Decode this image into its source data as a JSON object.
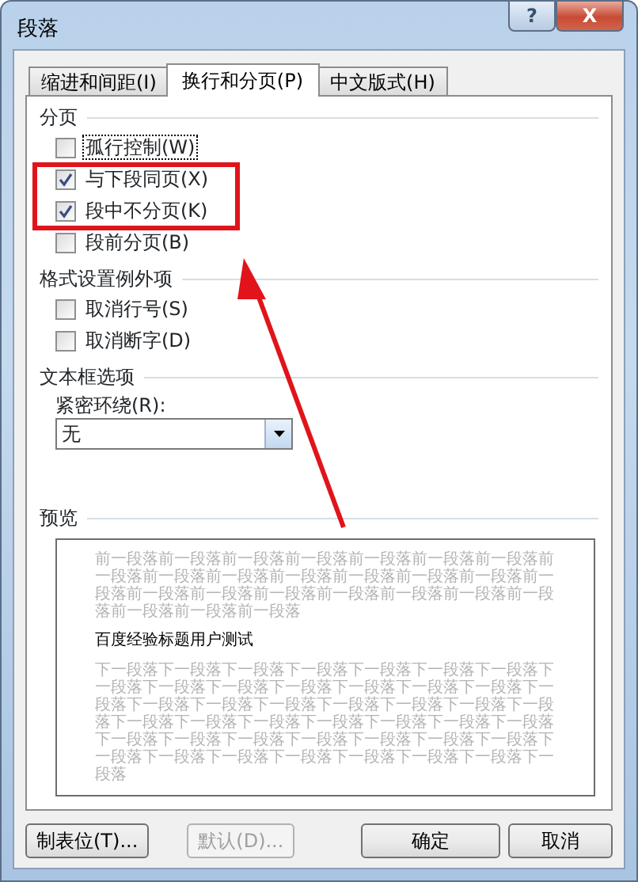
{
  "window": {
    "title": "段落",
    "buttons": [
      {
        "kind": "help",
        "label": "?"
      },
      {
        "kind": "close",
        "label": "X"
      }
    ]
  },
  "tabs": [
    {
      "label": "缩进和间距(I)",
      "selected": false
    },
    {
      "label": "换行和分页(P)",
      "selected": true
    },
    {
      "label": "中文版式(H)",
      "selected": false
    }
  ],
  "sections": [
    {
      "title": "分页",
      "items": [
        {
          "kind": "checkbox",
          "label": "孤行控制(W)",
          "checked": false,
          "focused": true
        },
        {
          "kind": "checkbox",
          "label": "与下段同页(X)",
          "checked": true,
          "focused": false
        },
        {
          "kind": "checkbox",
          "label": "段中不分页(K)",
          "checked": true,
          "focused": false
        },
        {
          "kind": "checkbox",
          "label": "段前分页(B)",
          "checked": false,
          "focused": false
        }
      ]
    },
    {
      "title": "格式设置例外项",
      "items": [
        {
          "kind": "checkbox",
          "label": "取消行号(S)",
          "checked": false,
          "focused": false
        },
        {
          "kind": "checkbox",
          "label": "取消断字(D)",
          "checked": false,
          "focused": false
        }
      ]
    },
    {
      "title": "文本框选项",
      "items": [
        {
          "kind": "label",
          "label": "紧密环绕(R):"
        },
        {
          "kind": "select",
          "value": "无"
        }
      ]
    }
  ],
  "preview": {
    "title": "预览",
    "before": "前一段落前一段落前一段落前一段落前一段落前一段落前一段落前一段落前一段落前一段落前一段落前一段落前一段落前一段落前一段落前一段落前一段落前一段落前一段落前一段落前一段落前一段落前一段落前一段落前一段落",
    "sample": "百度经验标题用户测试",
    "after": "下一段落下一段落下一段落下一段落下一段落下一段落下一段落下一段落下一段落下一段落下一段落下一段落下一段落下一段落下一段落下一段落下一段落下一段落下一段落下一段落下一段落下一段落下一段落下一段落下一段落下一段落下一段落下一段落下一段落下一段落下一段落下一段落下一段落下一段落下一段落下一段落下一段落下一段落下一段落下一段落下一段落下一段落下一段落下一段落"
  },
  "buttons": [
    {
      "label": "制表位(T)...",
      "disabled": false
    },
    {
      "label": "默认(D)...",
      "disabled": true
    },
    {
      "label": "确定",
      "disabled": false
    },
    {
      "label": "取消",
      "disabled": false
    }
  ],
  "annotation": {
    "kind": "box-with-arrow"
  }
}
